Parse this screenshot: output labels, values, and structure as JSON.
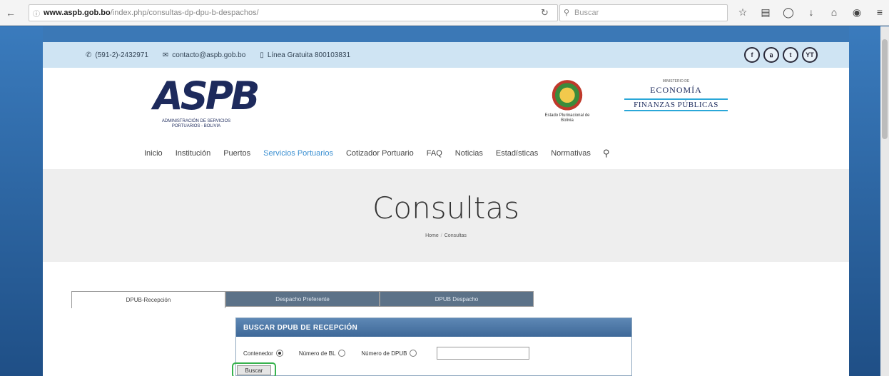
{
  "browser": {
    "url_domain": "www.aspb.gob.bo",
    "url_path": "/index.php/consultas-dp-dpu-b-despachos/",
    "search_placeholder": "Buscar"
  },
  "topbar": {
    "phone": "(591-2)-2432971",
    "email": "contacto@aspb.gob.bo",
    "hotline": "Línea Gratuita 800103831",
    "social": [
      "f",
      "อ",
      "t",
      "YT"
    ]
  },
  "header": {
    "logo_text": "ASPB",
    "logo_subtitle": "ADMINISTRACIÓN DE SERVICIOS PORTUARIOS - BOLIVIA",
    "crest_label": "Estado Plurinacional de Bolivia",
    "ministry_small": "MINISTERIO DE",
    "ministry_eco": "ECONOMÍA",
    "ministry_fin": "FINANZAS PÚBLICAS"
  },
  "nav": {
    "items": [
      "Inicio",
      "Institución",
      "Puertos",
      "Servicios Portuarios",
      "Cotizador Portuario",
      "FAQ",
      "Noticias",
      "Estadísticas",
      "Normativas"
    ],
    "active_index": 3
  },
  "hero": {
    "title": "Consultas",
    "breadcrumb_home": "Home",
    "breadcrumb_current": "Consultas"
  },
  "tabs": [
    "DPUB-Recepción",
    "Despacho Preferente",
    "DPUB Despacho"
  ],
  "form": {
    "title": "BUSCAR DPUB DE RECEPCIÓN",
    "options": [
      "Contenedor",
      "Número de BL",
      "Número de DPUB"
    ],
    "selected": "Contenedor",
    "search_label": "Buscar"
  },
  "colors": {
    "accent": "#3a8fd1",
    "topbar_bg": "#cfe4f3",
    "panel_header": "#3e6898",
    "highlight": "#37b24d"
  }
}
